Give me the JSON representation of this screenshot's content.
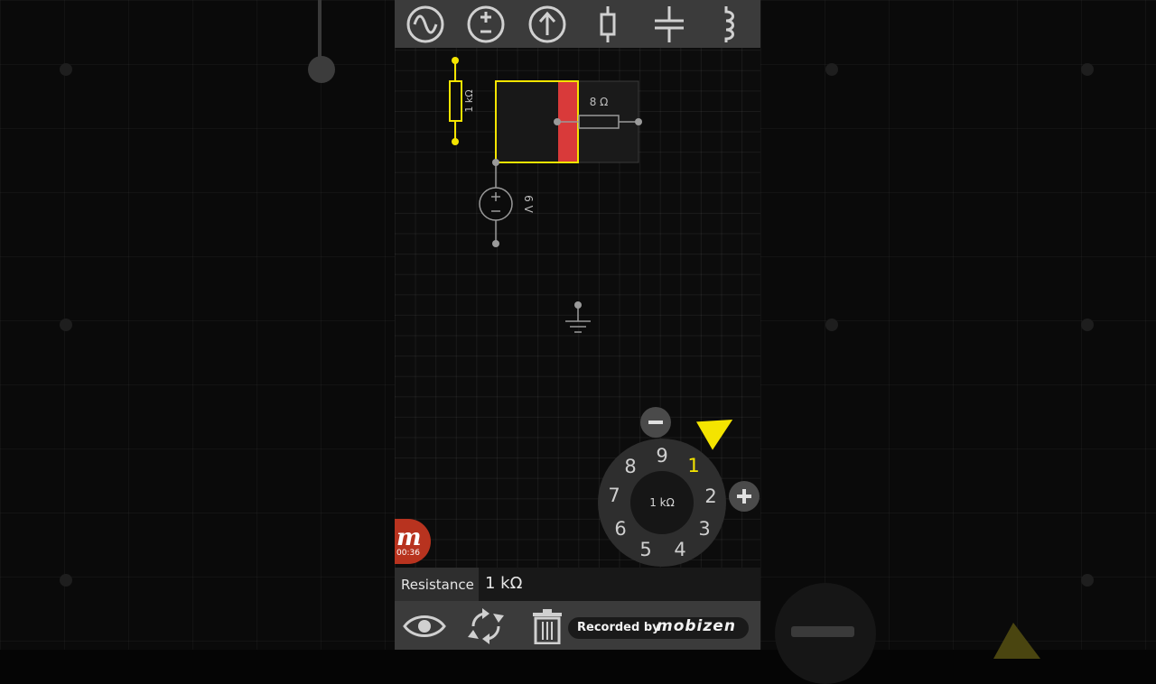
{
  "toolbar": {
    "tools": [
      {
        "icon": "ac-source-icon"
      },
      {
        "icon": "dc-voltage-source-icon"
      },
      {
        "icon": "current-source-icon"
      },
      {
        "icon": "resistor-icon"
      },
      {
        "icon": "capacitor-icon"
      },
      {
        "icon": "inductor-icon"
      }
    ]
  },
  "circuit": {
    "resistor_small_label": "1 kΩ",
    "resistor_large_label": "8 Ω",
    "voltage_source_label": "6 V"
  },
  "recorder": {
    "logo": "m",
    "time": "00:36"
  },
  "dial": {
    "center_label": "1 kΩ",
    "numbers": [
      "1",
      "2",
      "3",
      "4",
      "5",
      "6",
      "7",
      "8",
      "9"
    ],
    "active": "1"
  },
  "property": {
    "label": "Resistance",
    "value": "1 kΩ"
  },
  "watermark": {
    "text": "Recorded by",
    "brand": "mobizen"
  },
  "colors": {
    "selection": "#f4e400",
    "highlight": "#d93a3a",
    "toolbar": "#3b3b3b"
  }
}
